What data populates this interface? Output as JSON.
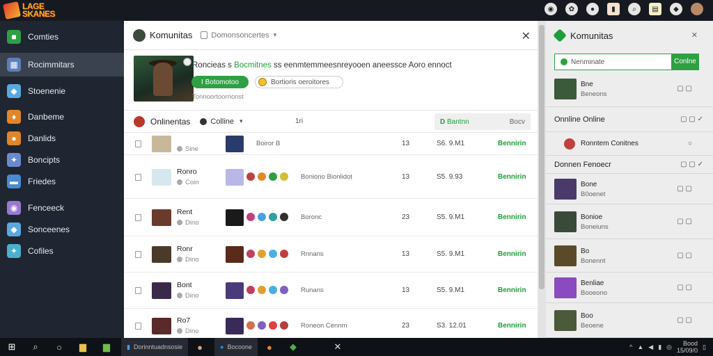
{
  "app": {
    "logo_text": "LAGE\nSKANES"
  },
  "topbar": {
    "icons": [
      "globe-icon",
      "flower-icon",
      "ball-icon",
      "flag-icon",
      "search-icon",
      "chart-icon",
      "bell-icon",
      "avatar"
    ]
  },
  "sidebar": {
    "items": [
      {
        "label": "Comties",
        "icon": "green-square-icon",
        "color": "#2ea043"
      },
      {
        "label": "Rocimmitars",
        "icon": "grid-icon",
        "color": "#5b7fb8",
        "active": true
      },
      {
        "label": "Stoenenie",
        "icon": "gem-icon",
        "color": "#5aa8e0"
      },
      {
        "label": "Danbeme",
        "icon": "flame-icon",
        "color": "#e0862a"
      },
      {
        "label": "Danlids",
        "icon": "orb-icon",
        "color": "#e0862a"
      },
      {
        "label": "Boncipts",
        "icon": "star-icon",
        "color": "#6a8ad0"
      },
      {
        "label": "Friedes",
        "icon": "book-icon",
        "color": "#4a8ad0"
      },
      {
        "label": "Fenceeck",
        "icon": "circle-icon",
        "color": "#9a7ad0"
      },
      {
        "label": "Sonceenes",
        "icon": "gem-icon",
        "color": "#5aa8e0"
      },
      {
        "label": "Cofiles",
        "icon": "star-icon",
        "color": "#4ab0d0"
      }
    ]
  },
  "panel": {
    "title": "Komunitas",
    "subtitle": "Domonsoncertes",
    "hero_text_a": "Roncieas s ",
    "hero_text_green": "Bocmitnes",
    "hero_text_b": " ss eenmtemmeesnreyooen aneessce Aoro ennoct",
    "primary_button": "I Botomotoo",
    "secondary_button": "Bortioris oeroitores",
    "small_note": "Tonnoortoorrionst",
    "filter_label": "Onlinentas",
    "filter_value": "Colline",
    "filter_count": "1ri",
    "search_left": "D",
    "search_left_text": "Bantnn",
    "search_right": "Bocv",
    "rows": [
      {
        "name": "",
        "status": "Sine",
        "game_desc": "Boiror  B",
        "c1": "13",
        "c2": "S6. 9.M1",
        "c3": "Bennirin"
      },
      {
        "name": "Ronro",
        "status": "Coin",
        "game_desc": "Boniono Bionlidot",
        "c1": "13",
        "c2": "S5. 9.93",
        "c3": "Bennirin"
      },
      {
        "name": "Rent",
        "status": "Dino",
        "game_desc": "Boronc",
        "c1": "23",
        "c2": "S5. 9.M1",
        "c3": "Bennirin"
      },
      {
        "name": "Ronr",
        "status": "Dino",
        "game_desc": "Rnnans",
        "c1": "13",
        "c2": "S5. 9.M1",
        "c3": "Bennirin"
      },
      {
        "name": "Bont",
        "status": "Dino",
        "game_desc": "Runans",
        "c1": "13",
        "c2": "S5. 9.M1",
        "c3": "Bennirin"
      },
      {
        "name": "Ro7",
        "status": "Dino",
        "game_desc": "Roneon Cennm",
        "c1": "23",
        "c2": "S3. 12.01",
        "c3": "Bennirin"
      }
    ]
  },
  "right": {
    "title": "Komunitas",
    "search_placeholder": "Nenminate",
    "search_button": "Conlne",
    "section_online": "Onnline Online",
    "section_other": "Donnen Fenoecr",
    "rows": [
      {
        "name": "Bne",
        "sub": "Beneons"
      },
      {
        "name": "Ronntem Conitnes",
        "sub": ""
      },
      {
        "name": "Bone",
        "sub": "B0oenet"
      },
      {
        "name": "Bonioe",
        "sub": "Boneiuns"
      },
      {
        "name": "Bo",
        "sub": "Bonennt"
      },
      {
        "name": "Benliae",
        "sub": "Booeono"
      },
      {
        "name": "Boo",
        "sub": "Beoene"
      }
    ]
  },
  "taskbar": {
    "app1": "Dorinntuadnsosie",
    "app2": "Bocoone",
    "time": "Bood",
    "date": "15/09/0"
  }
}
